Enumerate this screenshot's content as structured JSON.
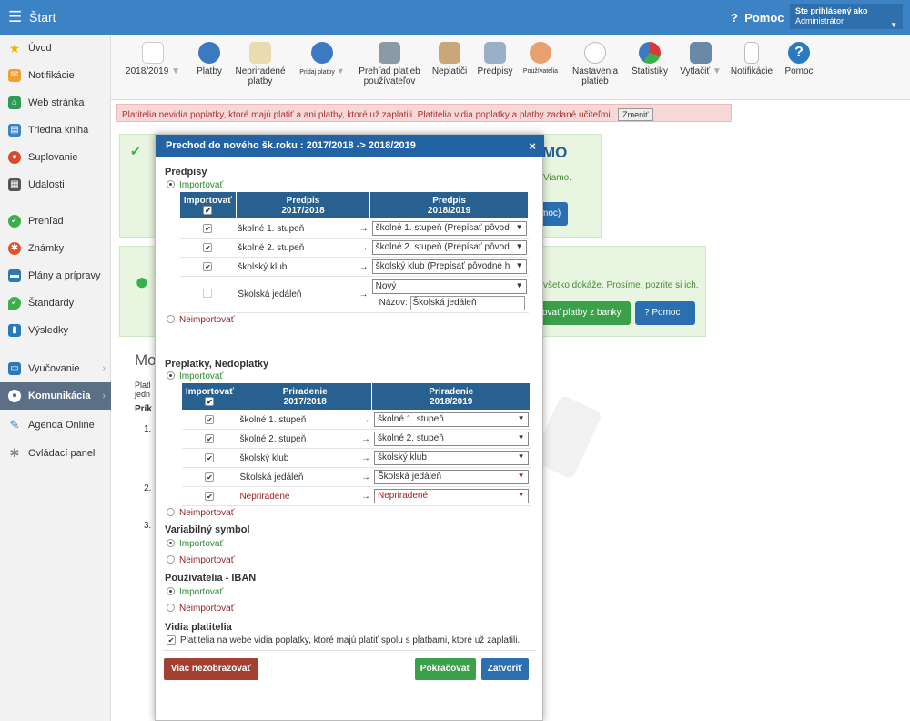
{
  "topbar": {
    "title": "Štart",
    "help": "Pomoc",
    "user_line1": "Ste prihlásený ako",
    "user_line2": "Administrátor"
  },
  "sidebar": {
    "items": [
      {
        "label": "Úvod"
      },
      {
        "label": "Notifikácie"
      },
      {
        "label": "Web stránka"
      },
      {
        "label": "Triedna kniha"
      },
      {
        "label": "Suplovanie"
      },
      {
        "label": "Udalosti"
      },
      {
        "label": "Prehľad"
      },
      {
        "label": "Známky"
      },
      {
        "label": "Plány a prípravy"
      },
      {
        "label": "Štandardy"
      },
      {
        "label": "Výsledky"
      },
      {
        "label": "Vyučovanie"
      },
      {
        "label": "Komunikácia"
      },
      {
        "label": "Agenda Online"
      },
      {
        "label": "Ovládací panel"
      }
    ]
  },
  "toolbar": {
    "year": "2018/2019",
    "platby": "Platby",
    "nepriradene1": "Nepriradené",
    "nepriradene2": "platby",
    "pridaj": "Pridaj platby",
    "prehlad1": "Prehľad platieb",
    "prehlad2": "používateľov",
    "neplatici": "Neplatiči",
    "predpisy": "Predpisy",
    "pouzivatelia": "Používatelia",
    "nastavenia1": "Nastavenia",
    "nastavenia2": "platieb",
    "statistiky": "Štatistiky",
    "vytlacit": "Vytlačiť",
    "notifikacie": "Notifikácie",
    "pomoc": "Pomoc"
  },
  "alert": {
    "text": "Platitelia nevidia poplatky, ktoré majú platiť a ani platby, ktoré už zaplatili. Platitelia vidia poplatky a platby zadané učiteľmi.",
    "button": "Zmeniť"
  },
  "background": {
    "vzmo": "MO",
    "viamo": "Viamo.",
    "moc": "moc)",
    "vsetko": "všetko dokáže. Prosíme, pozrite si ich.",
    "bank_button": "ovať platby z banky",
    "help_button": "Pomoc",
    "heading": "Mo",
    "p1": "Platl",
    "p2": "jedn",
    "p3": "Prík",
    "n1": "1.",
    "n2": "2.",
    "n3": "3."
  },
  "modal": {
    "title": "Prechod do nového šk.roku : 2017/2018 -> 2018/2019",
    "close": "×",
    "predpisy": {
      "title": "Predpisy",
      "import": "Importovať",
      "noimport": "Neimportovať",
      "col_import": "Importovať",
      "col_old1": "Predpis",
      "col_old2": "2017/2018",
      "col_new1": "Predpis",
      "col_new2": "2018/2019",
      "rows": [
        {
          "old": "školné 1. stupeň",
          "new": "školné 1. stupeň (Prepísať pôvod"
        },
        {
          "old": "školné 2. stupeň",
          "new": "školné 2. stupeň (Prepísať pôvod"
        },
        {
          "old": "školský klub",
          "new": "školský klub (Prepísať pôvodné h"
        },
        {
          "old": "Školská jedáleň",
          "new": "Nový",
          "name_label": "Názov:",
          "name_value": "Školská jedáleň"
        }
      ]
    },
    "preplatky": {
      "title": "Preplatky, Nedoplatky",
      "import": "Importovať",
      "noimport": "Neimportovať",
      "col_import": "Importovať",
      "col_old1": "Priradenie",
      "col_old2": "2017/2018",
      "col_new1": "Priradenie",
      "col_new2": "2018/2019",
      "rows": [
        {
          "old": "školné 1. stupeň",
          "new": "školné 1. stupeň"
        },
        {
          "old": "školné 2. stupeň",
          "new": "školné 2. stupeň"
        },
        {
          "old": "školský klub",
          "new": "školský klub"
        },
        {
          "old": "Školská jedáleň",
          "new": "Školská jedáleň"
        },
        {
          "old": "Nepriradené",
          "new": "Nepriradené"
        }
      ]
    },
    "variabilny": {
      "title": "Variabilný symbol",
      "import": "Importovať",
      "noimport": "Neimportovať"
    },
    "iban": {
      "title": "Používatelia - IBAN",
      "import": "Importovať",
      "noimport": "Neimportovať"
    },
    "vidia": {
      "title": "Vidia platitelia",
      "checkbox": "Platitelia na webe vidia poplatky, ktoré majú platiť spolu s platbami, ktoré už zaplatili."
    },
    "buttons": {
      "hide": "Viac nezobrazovať",
      "continue": "Pokračovať",
      "close": "Zatvoriť"
    },
    "arrow": "→",
    "check": "✔",
    "caret": "▼"
  }
}
